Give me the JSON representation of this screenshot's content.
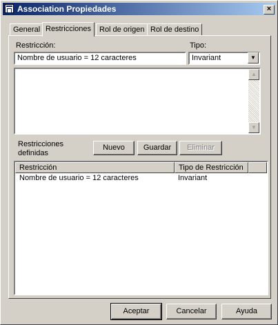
{
  "window": {
    "title": "Association Propiedades",
    "close_glyph": "×"
  },
  "tabs": [
    {
      "label": "General",
      "active": false
    },
    {
      "label": "Restricciones",
      "active": true
    },
    {
      "label": "Rol de origen",
      "active": false
    },
    {
      "label": "Rol de destino",
      "active": false
    }
  ],
  "form": {
    "restriction_label": "Restricción:",
    "restriction_value": "Nombre de usuario = 12 caracteres",
    "type_label": "Tipo:",
    "type_value": "Invariant",
    "defined_label_line1": "Restricciones",
    "defined_label_line2": "definidas",
    "new_button": "Nuevo",
    "save_button": "Guardar",
    "delete_button": "Eliminar"
  },
  "list": {
    "columns": [
      "Restricción",
      "Tipo de Restricción"
    ],
    "rows": [
      [
        "Nombre de usuario = 12 caracteres",
        "Invariant"
      ]
    ]
  },
  "footer": {
    "accept": "Aceptar",
    "cancel": "Cancelar",
    "help": "Ayuda"
  }
}
